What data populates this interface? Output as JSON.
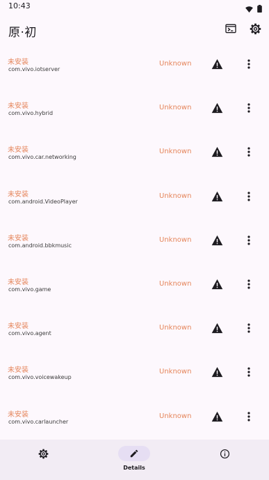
{
  "status_bar": {
    "time": "10:43"
  },
  "app_bar": {
    "title": "原·初"
  },
  "colors": {
    "status_orange": "#e5855b",
    "background": "#fdf8fd",
    "nav_background": "#f2ecf4",
    "nav_active": "#e6def3"
  },
  "items": [
    {
      "status": "未安装",
      "package": "com.vivo.iotserver",
      "version": "Unknown"
    },
    {
      "status": "未安装",
      "package": "com.vivo.hybrid",
      "version": "Unknown"
    },
    {
      "status": "未安装",
      "package": "com.vivo.car.networking",
      "version": "Unknown"
    },
    {
      "status": "未安装",
      "package": "com.android.VideoPlayer",
      "version": "Unknown"
    },
    {
      "status": "未安装",
      "package": "com.android.bbkmusic",
      "version": "Unknown"
    },
    {
      "status": "未安装",
      "package": "com.vivo.game",
      "version": "Unknown"
    },
    {
      "status": "未安装",
      "package": "com.vivo.agent",
      "version": "Unknown"
    },
    {
      "status": "未安装",
      "package": "com.vivo.voicewakeup",
      "version": "Unknown"
    },
    {
      "status": "未安装",
      "package": "com.vivo.carlauncher",
      "version": "Unknown"
    }
  ],
  "bottom_nav": {
    "items": [
      {
        "icon": "gear-icon",
        "label": ""
      },
      {
        "icon": "pencil-icon",
        "label": "Details",
        "active": true
      },
      {
        "icon": "info-icon",
        "label": ""
      }
    ]
  }
}
